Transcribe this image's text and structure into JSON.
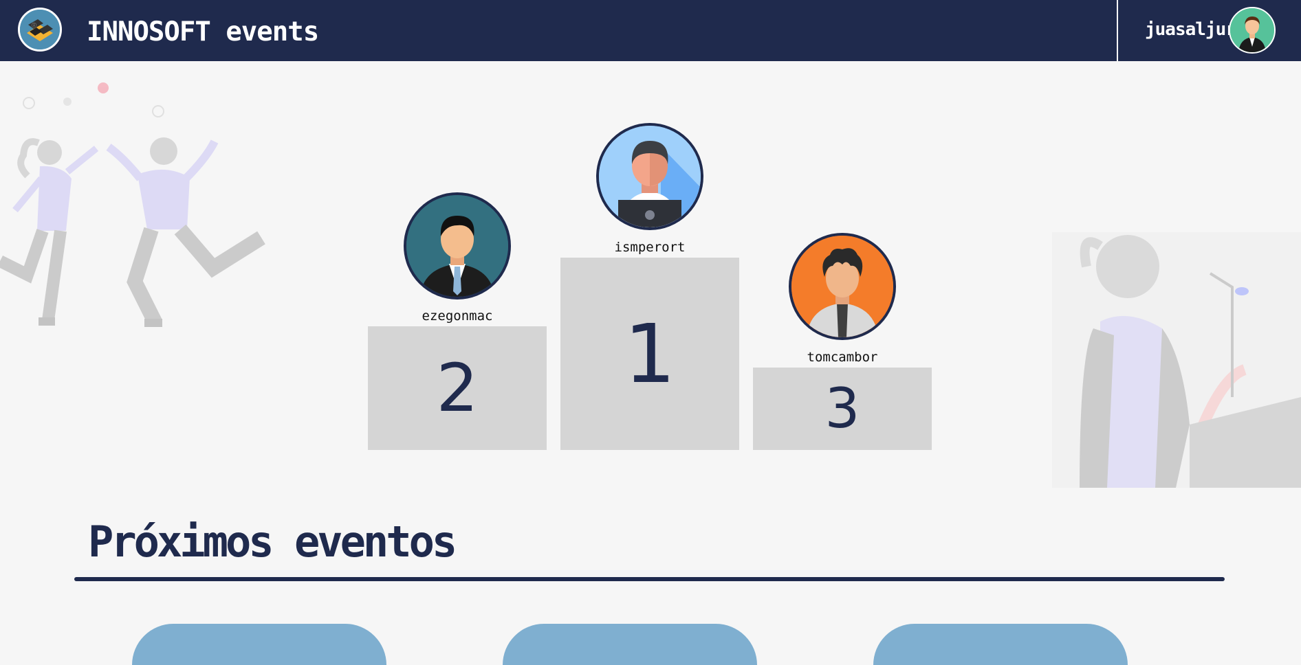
{
  "navbar": {
    "title": "INNOSOFT events",
    "username": "juasaljur"
  },
  "podium": [
    {
      "rank": "2",
      "username": "ezegonmac",
      "avatar": "man-suit-avatar",
      "avatar_bg": "#337080"
    },
    {
      "rank": "1",
      "username": "ismperort",
      "avatar": "man-laptop-avatar",
      "avatar_bg": "#9fd0fb"
    },
    {
      "rank": "3",
      "username": "tomcambor",
      "avatar": "man-tie-avatar",
      "avatar_bg": "#f47c2a"
    }
  ],
  "events_section": {
    "title": "Próximos eventos"
  },
  "colors": {
    "navy": "#1f2a4d",
    "podium_block": "#d5d5d5",
    "background": "#f6f6f6",
    "card": "#7fafd0"
  }
}
